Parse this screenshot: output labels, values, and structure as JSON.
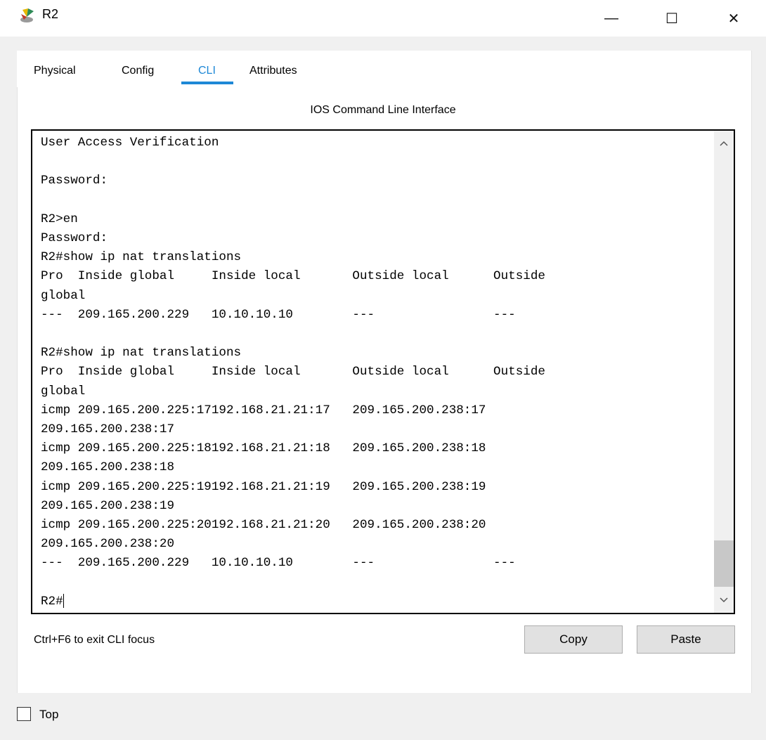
{
  "window": {
    "title": "R2",
    "minimize_glyph": "—",
    "maximize_glyph": "☐",
    "close_glyph": "✕"
  },
  "tabs": [
    {
      "label": "Physical"
    },
    {
      "label": "Config"
    },
    {
      "label": "CLI",
      "active": true
    },
    {
      "label": "Attributes"
    }
  ],
  "cli": {
    "title": "IOS Command Line Interface",
    "lines": [
      "User Access Verification",
      "",
      "Password:",
      "",
      "R2>en",
      "Password:",
      "R2#show ip nat translations",
      "Pro  Inside global     Inside local       Outside local      Outside",
      "global",
      "---  209.165.200.229   10.10.10.10        ---                ---",
      "",
      "R2#show ip nat translations",
      "Pro  Inside global     Inside local       Outside local      Outside",
      "global",
      "icmp 209.165.200.225:17192.168.21.21:17   209.165.200.238:17",
      "209.165.200.238:17",
      "icmp 209.165.200.225:18192.168.21.21:18   209.165.200.238:18",
      "209.165.200.238:18",
      "icmp 209.165.200.225:19192.168.21.21:19   209.165.200.238:19",
      "209.165.200.238:19",
      "icmp 209.165.200.225:20192.168.21.21:20   209.165.200.238:20",
      "209.165.200.238:20",
      "---  209.165.200.229   10.10.10.10        ---                ---",
      ""
    ],
    "prompt": "R2#"
  },
  "footer": {
    "hint": "Ctrl+F6 to exit CLI focus",
    "copy_label": "Copy",
    "paste_label": "Paste"
  },
  "bottom": {
    "top_label": "Top",
    "top_checked": false
  },
  "colors": {
    "accent": "#1e88d6",
    "frame_bg": "#f0f0f0"
  }
}
